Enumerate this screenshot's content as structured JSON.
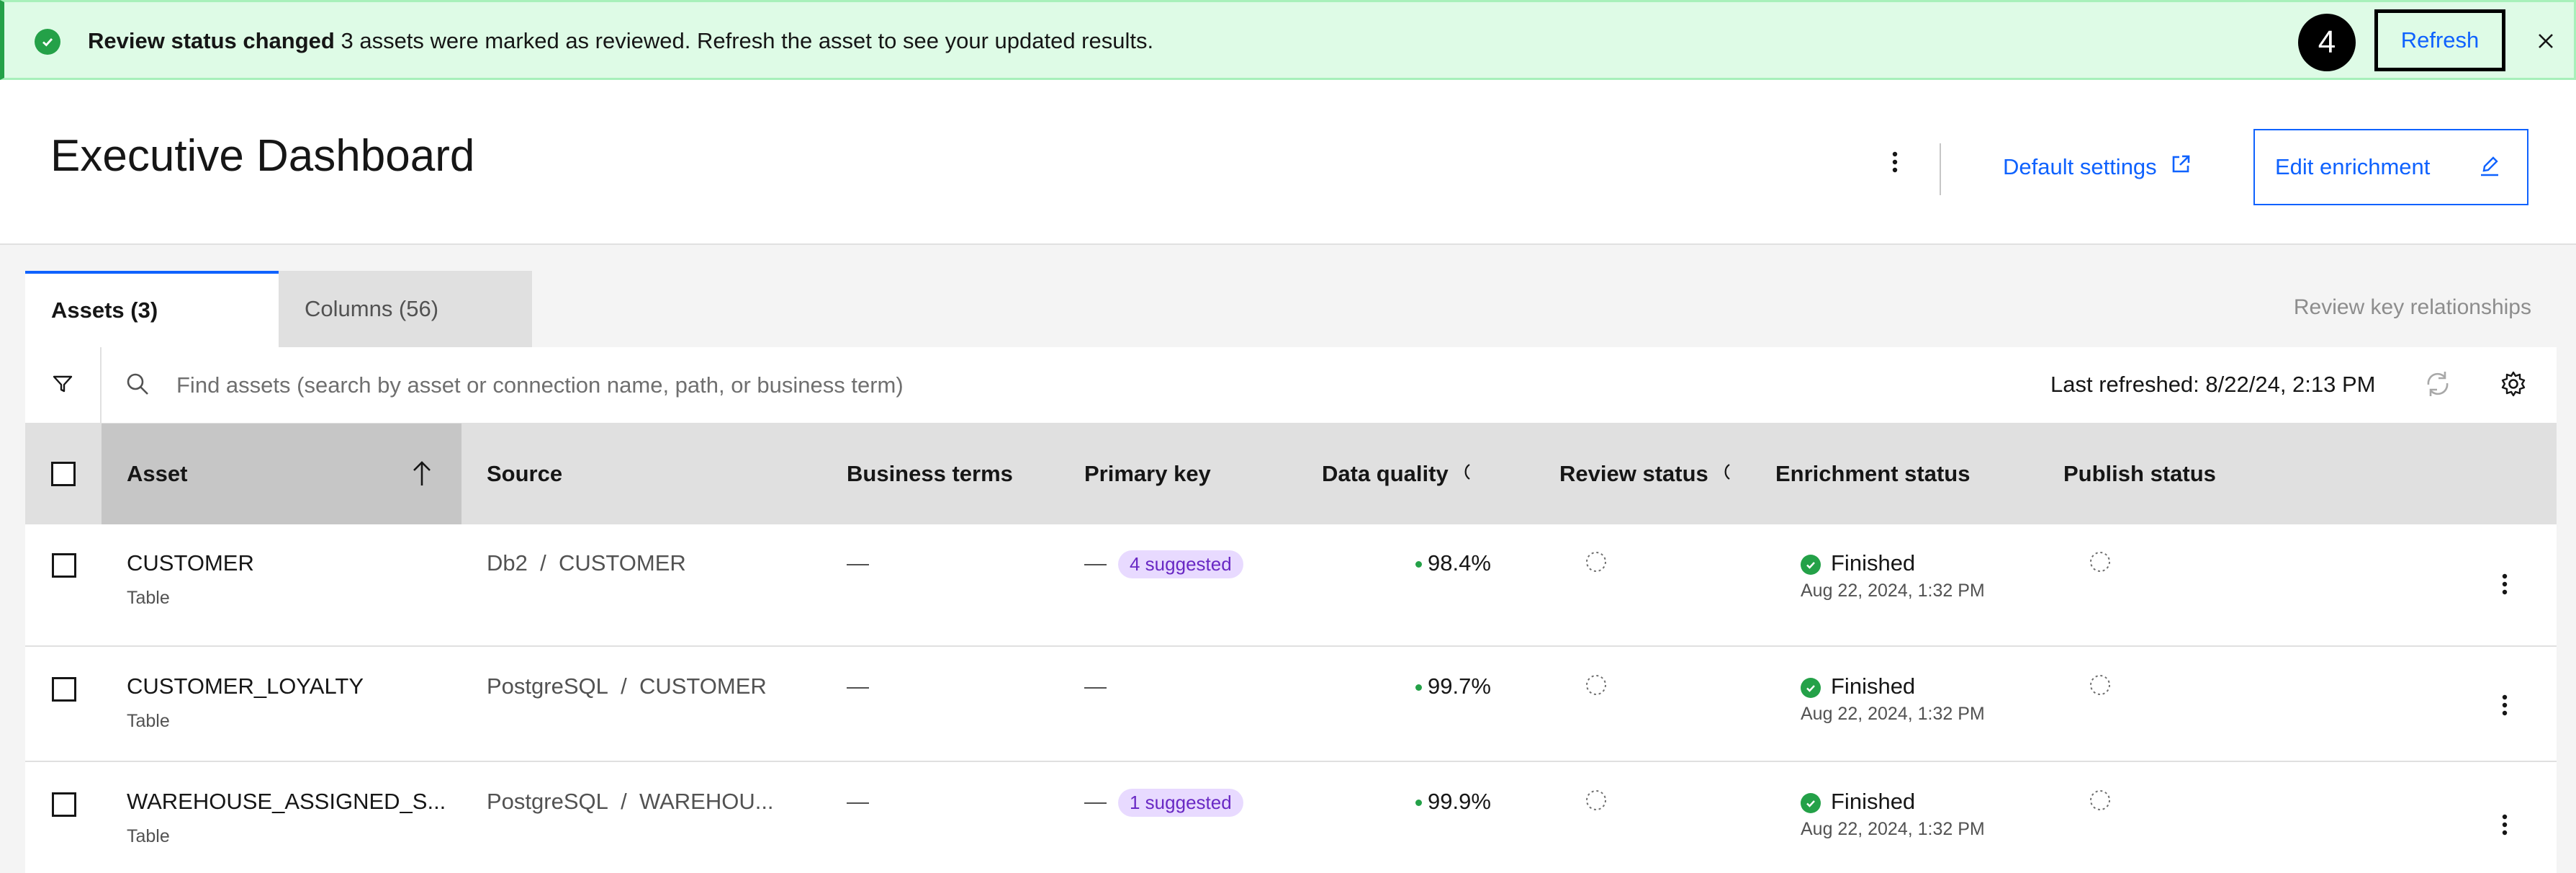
{
  "notification": {
    "title": "Review status changed",
    "message": "3 assets were marked as reviewed. Refresh the asset to see your updated results.",
    "step": "4",
    "refresh_label": "Refresh"
  },
  "header": {
    "title": "Executive Dashboard",
    "default_settings_label": "Default settings",
    "edit_enrichment_label": "Edit enrichment"
  },
  "tabs": [
    {
      "label": "Assets (3)",
      "selected": true
    },
    {
      "label": "Columns (56)",
      "selected": false
    }
  ],
  "review_key_label": "Review key relationships",
  "toolbar": {
    "search_placeholder": "Find assets (search by asset or connection name, path, or business term)",
    "last_refreshed": "Last refreshed: 8/22/24, 2:13 PM"
  },
  "table": {
    "columns": {
      "asset": "Asset",
      "source": "Source",
      "business_terms": "Business terms",
      "primary_key": "Primary key",
      "data_quality": "Data quality",
      "review_status": "Review status",
      "enrichment_status": "Enrichment status",
      "publish_status": "Publish status"
    },
    "rows": [
      {
        "asset": "CUSTOMER",
        "type": "Table",
        "source_db": "Db2",
        "source_sep": "/",
        "source_table": "CUSTOMER",
        "business_terms": "—",
        "primary_key": "—",
        "primary_key_tag": "4 suggested",
        "data_quality": "98.4%",
        "enrichment": "Finished",
        "enrichment_time": "Aug 22, 2024, 1:32 PM"
      },
      {
        "asset": "CUSTOMER_LOYALTY",
        "type": "Table",
        "source_db": "PostgreSQL",
        "source_sep": "/",
        "source_table": "CUSTOMER",
        "business_terms": "—",
        "primary_key": "—",
        "primary_key_tag": "",
        "data_quality": "99.7%",
        "enrichment": "Finished",
        "enrichment_time": "Aug 22, 2024, 1:32 PM"
      },
      {
        "asset": "WAREHOUSE_ASSIGNED_S...",
        "type": "Table",
        "source_db": "PostgreSQL",
        "source_sep": "/",
        "source_table": "WAREHOU...",
        "business_terms": "—",
        "primary_key": "—",
        "primary_key_tag": "1 suggested",
        "data_quality": "99.9%",
        "enrichment": "Finished",
        "enrichment_time": "Aug 22, 2024, 1:32 PM"
      }
    ]
  },
  "colors": {
    "accent": "#0f62fe",
    "success": "#24a148",
    "notification_bg": "#defbe6",
    "tag_bg": "#e8daff",
    "tag_text": "#6929c4"
  },
  "icons": [
    "checkmark-filled-icon",
    "close-icon",
    "overflow-menu-icon",
    "launch-icon",
    "edit-icon",
    "filter-icon",
    "search-icon",
    "renew-icon",
    "settings-icon",
    "arrow-up-icon",
    "pending-icon"
  ]
}
